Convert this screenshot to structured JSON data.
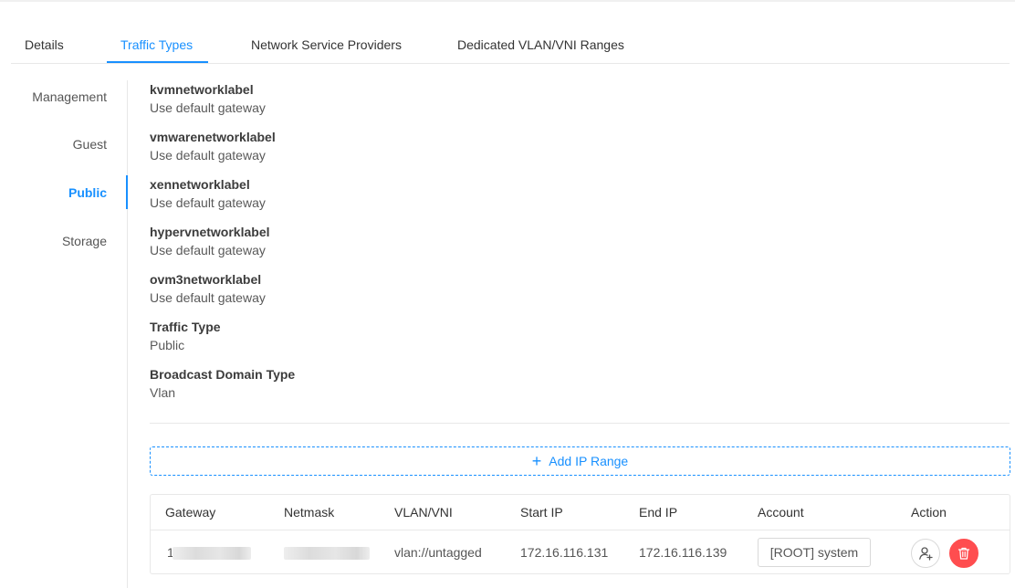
{
  "tabs": [
    {
      "label": "Details"
    },
    {
      "label": "Traffic Types"
    },
    {
      "label": "Network Service Providers"
    },
    {
      "label": "Dedicated VLAN/VNI Ranges"
    }
  ],
  "active_tab": "Traffic Types",
  "side_menu": [
    {
      "label": "Management"
    },
    {
      "label": "Guest"
    },
    {
      "label": "Public"
    },
    {
      "label": "Storage"
    }
  ],
  "active_side_item": "Public",
  "details": [
    {
      "label": "kvmnetworklabel",
      "value": "Use default gateway"
    },
    {
      "label": "vmwarenetworklabel",
      "value": "Use default gateway"
    },
    {
      "label": "xennetworklabel",
      "value": "Use default gateway"
    },
    {
      "label": "hypervnetworklabel",
      "value": "Use default gateway"
    },
    {
      "label": "ovm3networklabel",
      "value": "Use default gateway"
    },
    {
      "label": "Traffic Type",
      "value": "Public"
    },
    {
      "label": "Broadcast Domain Type",
      "value": "Vlan"
    }
  ],
  "add_ip_range": {
    "icon": "plus-icon",
    "label": "Add IP Range"
  },
  "ip_table": {
    "columns": [
      "Gateway",
      "Netmask",
      "VLAN/VNI",
      "Start IP",
      "End IP",
      "Account",
      "Action"
    ],
    "rows": [
      {
        "gateway": "1",
        "netmask": "",
        "vlan": "vlan://untagged",
        "start_ip": "172.16.116.131",
        "end_ip": "172.16.116.139",
        "account": "[ROOT] system"
      }
    ]
  },
  "colors": {
    "accent": "#1890ff",
    "danger": "#ff4d4f",
    "border": "#e8e8e8"
  },
  "icons": {
    "user_action": "user-add-icon",
    "delete_action": "trash-icon"
  }
}
